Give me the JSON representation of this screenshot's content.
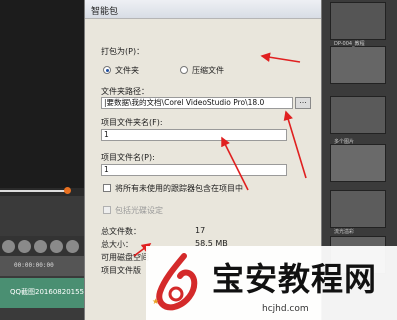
{
  "editor": {
    "ruler_time": "00:00:00:00",
    "track_clip_label": "QQ截图20160820155",
    "top_thumb_label": "Triple",
    "thumb_labels": [
      "",
      "DP-004_教程",
      "",
      "多个图片",
      "",
      "流光溢彩"
    ]
  },
  "dialog": {
    "title": "智能包",
    "pack_as_label": "打包为(P)：",
    "pack_options": [
      {
        "label": "文件夹",
        "selected": true
      },
      {
        "label": "压缩文件",
        "selected": false
      }
    ],
    "folder_path_label": "文件夹路径：",
    "folder_path_value": "|要数据\\我的文档\\Corel VideoStudio Pro\\18.0",
    "browse_label": "...",
    "project_folder_label": "项目文件夹名(F):",
    "project_folder_value": "1",
    "project_file_label": "项目文件名(P):",
    "project_file_value": "1",
    "include_unused_label": "将所有未使用的跟踪器包含在项目中",
    "include_subtitle_label": "包括光碟设定",
    "total_files_label": "总文件数：",
    "total_files_value": "17",
    "total_size_label": "总大小：",
    "total_size_value": "58.5 MB",
    "disk_space_label": "可用磁盘空间",
    "project_version_label": "项目文件版"
  },
  "watermark": {
    "title": "宝安教程网",
    "url": "hcjhd.com"
  },
  "colors": {
    "annotation_red": "#e02020",
    "dialog_bg": "#e9e6dc",
    "track_green": "#4a8f72",
    "logo_red": "#d42a2a"
  }
}
